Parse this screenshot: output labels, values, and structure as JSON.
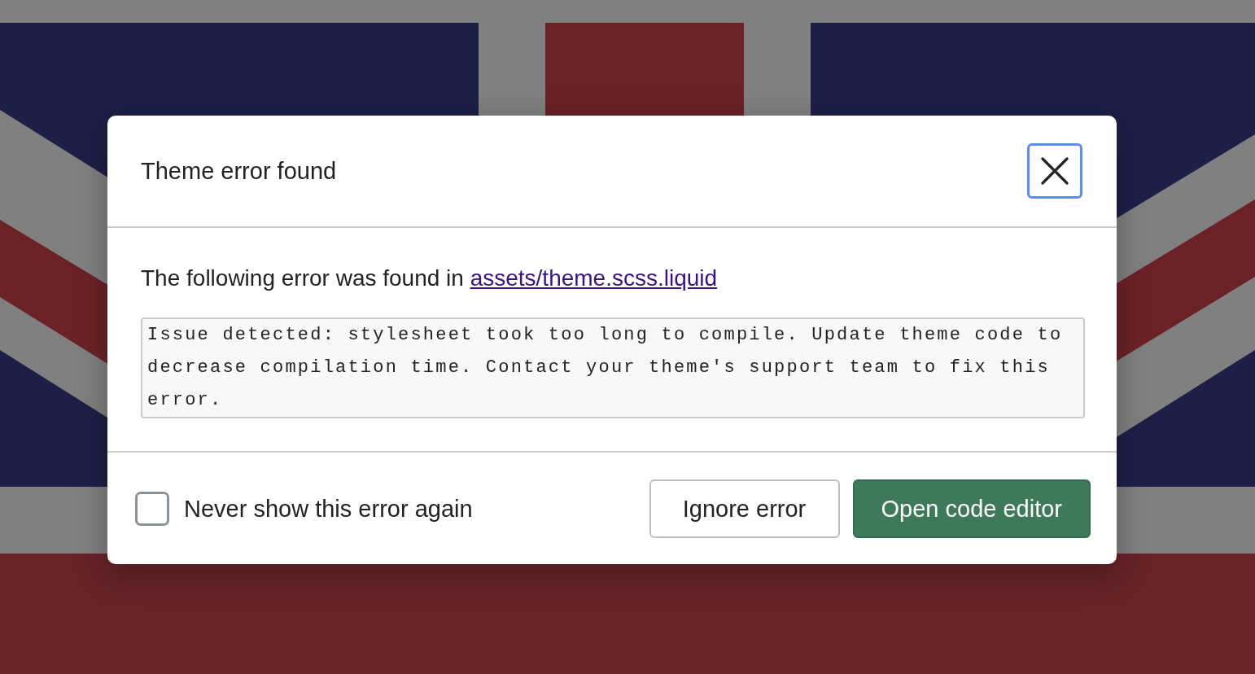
{
  "dialog": {
    "title": "Theme error found",
    "close_button": {
      "focused": true
    },
    "message": "The following error was found in",
    "file_link": "assets/theme.scss.liquid",
    "error_details": "Issue detected: stylesheet took too long to compile. Update theme code to decrease compilation time. Contact your theme's support team to fix this error.",
    "never_show": {
      "label": "Never show this error again",
      "checked": false
    },
    "buttons": [
      {
        "label": "Ignore error",
        "kind": "secondary"
      },
      {
        "label": "Open code editor",
        "kind": "primary"
      }
    ]
  }
}
